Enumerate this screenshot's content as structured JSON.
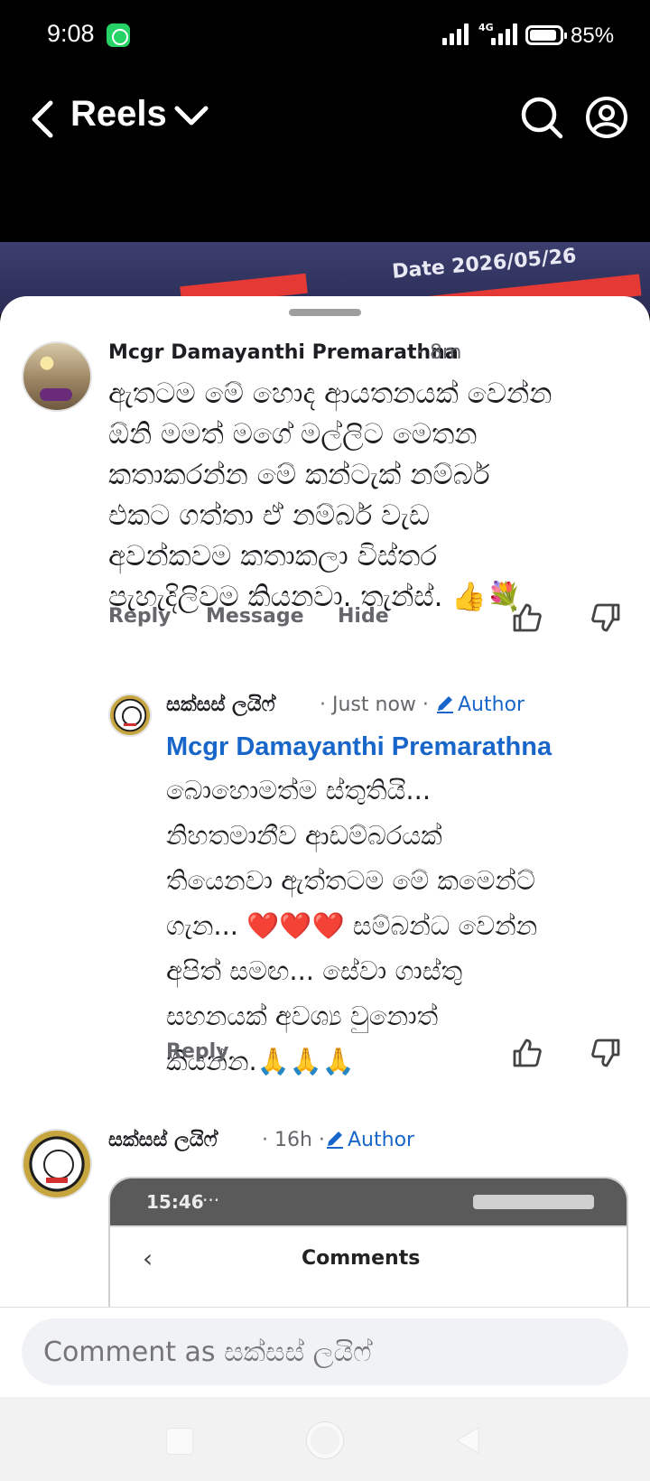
{
  "status_bar": {
    "time": "9:08",
    "network": "4G",
    "battery": "85%"
  },
  "header": {
    "title": "Reels"
  },
  "video": {
    "date_text": "Date 2026/05/26"
  },
  "comments": [
    {
      "author": "Mcgr Damayanthi Premarathna",
      "time": "· 8m",
      "lines": [
        "ඇතටම මේ හොද ආයතනයක් වෙන්න",
        "ඕනි මමත් මගේ මල්ලිට මෙතන",
        "කතාකරන්න මේ කන්ටැක් නම්බර්",
        "එකට ගත්තා ඒ නම්බර් වැඩ",
        "අවන්කවම කතාකලා විස්තර",
        "පැහැදිලිවම කියනවා. තැන්ස්. 👍💐"
      ],
      "actions": {
        "reply": "Reply",
        "message": "Message",
        "hide": "Hide"
      }
    },
    {
      "author": "සක්සස් ලයිෆ්",
      "time": "· Just now ·",
      "badge": "Author",
      "mention": "Mcgr Damayanthi Premarathna",
      "lines": [
        "බොහොමත්ම ස්තුතියි...",
        "නිහතමානීව ආඩම්බරයක්",
        "තියෙනවා ඇත්තටම මේ කමෙන්ට්",
        "ගැන... ❤️❤️❤️ සම්බන්ධ වෙන්න",
        "අපිත් සමඟ... සේවා ගාස්තු",
        "සහනයක් අවශ්‍ය වුනොත්",
        "කියන්න.🙏🙏🙏"
      ],
      "actions": {
        "reply": "Reply"
      }
    },
    {
      "author": "සක්සස් ලයිෆ්",
      "time": "· 16h ·",
      "badge": "Author",
      "image": {
        "time": "15:46",
        "dots": "···",
        "title": "Comments"
      }
    }
  ],
  "input": {
    "placeholder": "Comment as සක්සස් ලයිෆ්"
  },
  "icons": [
    "back-icon",
    "chevron-down-icon",
    "search-icon",
    "profile-icon",
    "like-icon",
    "dislike-icon",
    "pencil-icon"
  ]
}
